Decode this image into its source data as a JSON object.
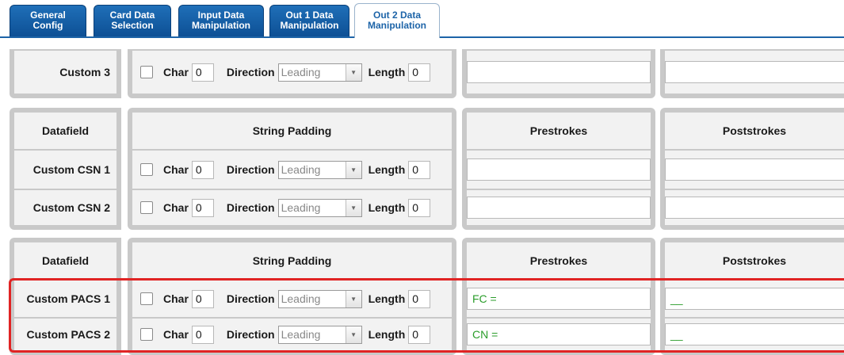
{
  "tabs": [
    {
      "label": "General\nConfig"
    },
    {
      "label": "Card Data\nSelection"
    },
    {
      "label": "Input Data\nManipulation"
    },
    {
      "label": "Out 1 Data\nManipulation"
    },
    {
      "label": "Out 2 Data\nManipulation",
      "active": true
    }
  ],
  "headers": {
    "datafield": "Datafield",
    "padding": "String Padding",
    "prestrokes": "Prestrokes",
    "poststrokes": "Poststrokes"
  },
  "labels": {
    "char": "Char",
    "direction": "Direction",
    "length": "Length"
  },
  "rows": [
    {
      "name": "Custom 3",
      "char": "0",
      "direction": "Leading",
      "length": "0",
      "prestrokes": "",
      "poststrokes": ""
    },
    {
      "name": "Custom CSN 1",
      "char": "0",
      "direction": "Leading",
      "length": "0",
      "prestrokes": "",
      "poststrokes": ""
    },
    {
      "name": "Custom CSN 2",
      "char": "0",
      "direction": "Leading",
      "length": "0",
      "prestrokes": "",
      "poststrokes": ""
    },
    {
      "name": "Custom PACS 1",
      "char": "0",
      "direction": "Leading",
      "length": "0",
      "prestrokes": "FC =",
      "poststrokes": "__"
    },
    {
      "name": "Custom PACS 2",
      "char": "0",
      "direction": "Leading",
      "length": "0",
      "prestrokes": "CN =",
      "poststrokes": "__"
    }
  ],
  "colors": {
    "tab_blue": "#1d64a8",
    "cell_grey": "#c9c9c9",
    "highlight_red": "#e02424",
    "value_green": "#2a9d2a"
  },
  "icons": {
    "dropdown": "triangle-down"
  }
}
